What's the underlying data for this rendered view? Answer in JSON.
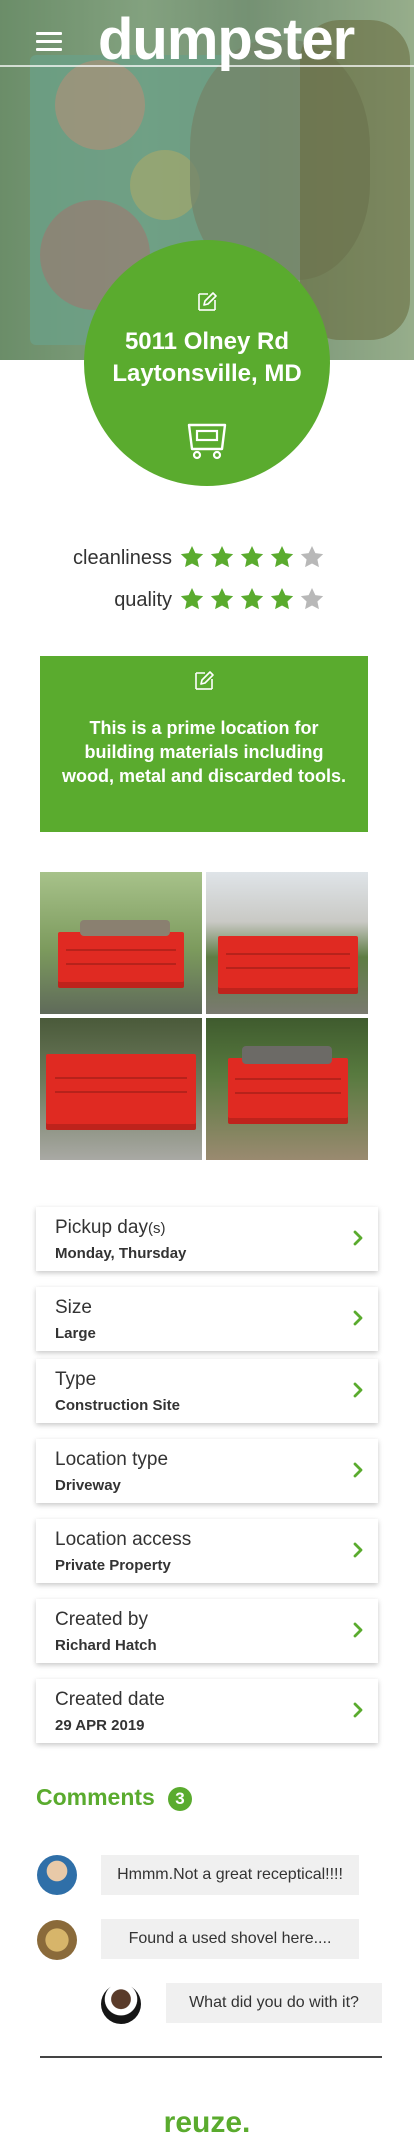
{
  "header": {
    "brand": "dumpster",
    "menu_icon": "hamburger-menu-icon"
  },
  "location": {
    "address_line1": "5011 Olney Rd",
    "address_line2": "Laytonsville, MD",
    "edit_icon": "edit-icon",
    "dumpster_icon": "dumpster-icon"
  },
  "ratings": [
    {
      "label": "cleanliness",
      "stars": 4,
      "max": 5
    },
    {
      "label": "quality",
      "stars": 4,
      "max": 5
    }
  ],
  "description": {
    "edit_icon": "edit-icon",
    "text": "This is a prime location for building materials including wood, metal and discarded tools."
  },
  "photos": [
    "dumpster-photo-1",
    "dumpster-photo-2",
    "dumpster-photo-3",
    "dumpster-photo-4"
  ],
  "details": [
    {
      "label": "Pickup day",
      "label_suffix": "(s)",
      "value": "Monday, Thursday"
    },
    {
      "label": "Size",
      "label_suffix": "",
      "value": "Large"
    },
    {
      "label": "Type",
      "label_suffix": "",
      "value": "Construction Site"
    },
    {
      "label": "Location type",
      "label_suffix": "",
      "value": "Driveway"
    },
    {
      "label": "Location access",
      "label_suffix": "",
      "value": "Private Property"
    },
    {
      "label": "Created by",
      "label_suffix": "",
      "value": "Richard Hatch"
    },
    {
      "label": "Created date",
      "label_suffix": "",
      "value": "29 APR 2019"
    }
  ],
  "comments": {
    "title": "Comments",
    "count": "3",
    "items": [
      {
        "text": "Hmmm.Not a great  receptical!!!!"
      },
      {
        "text": "Found a used shovel here...."
      },
      {
        "text": "What did you do with it?"
      }
    ]
  },
  "footer": {
    "logo": "reuze",
    "logo_dot": "."
  },
  "colors": {
    "accent": "#5aab2e",
    "star_filled": "#5aab2e",
    "star_empty": "#b8b8b8",
    "dumpster_red": "#e02a22"
  }
}
